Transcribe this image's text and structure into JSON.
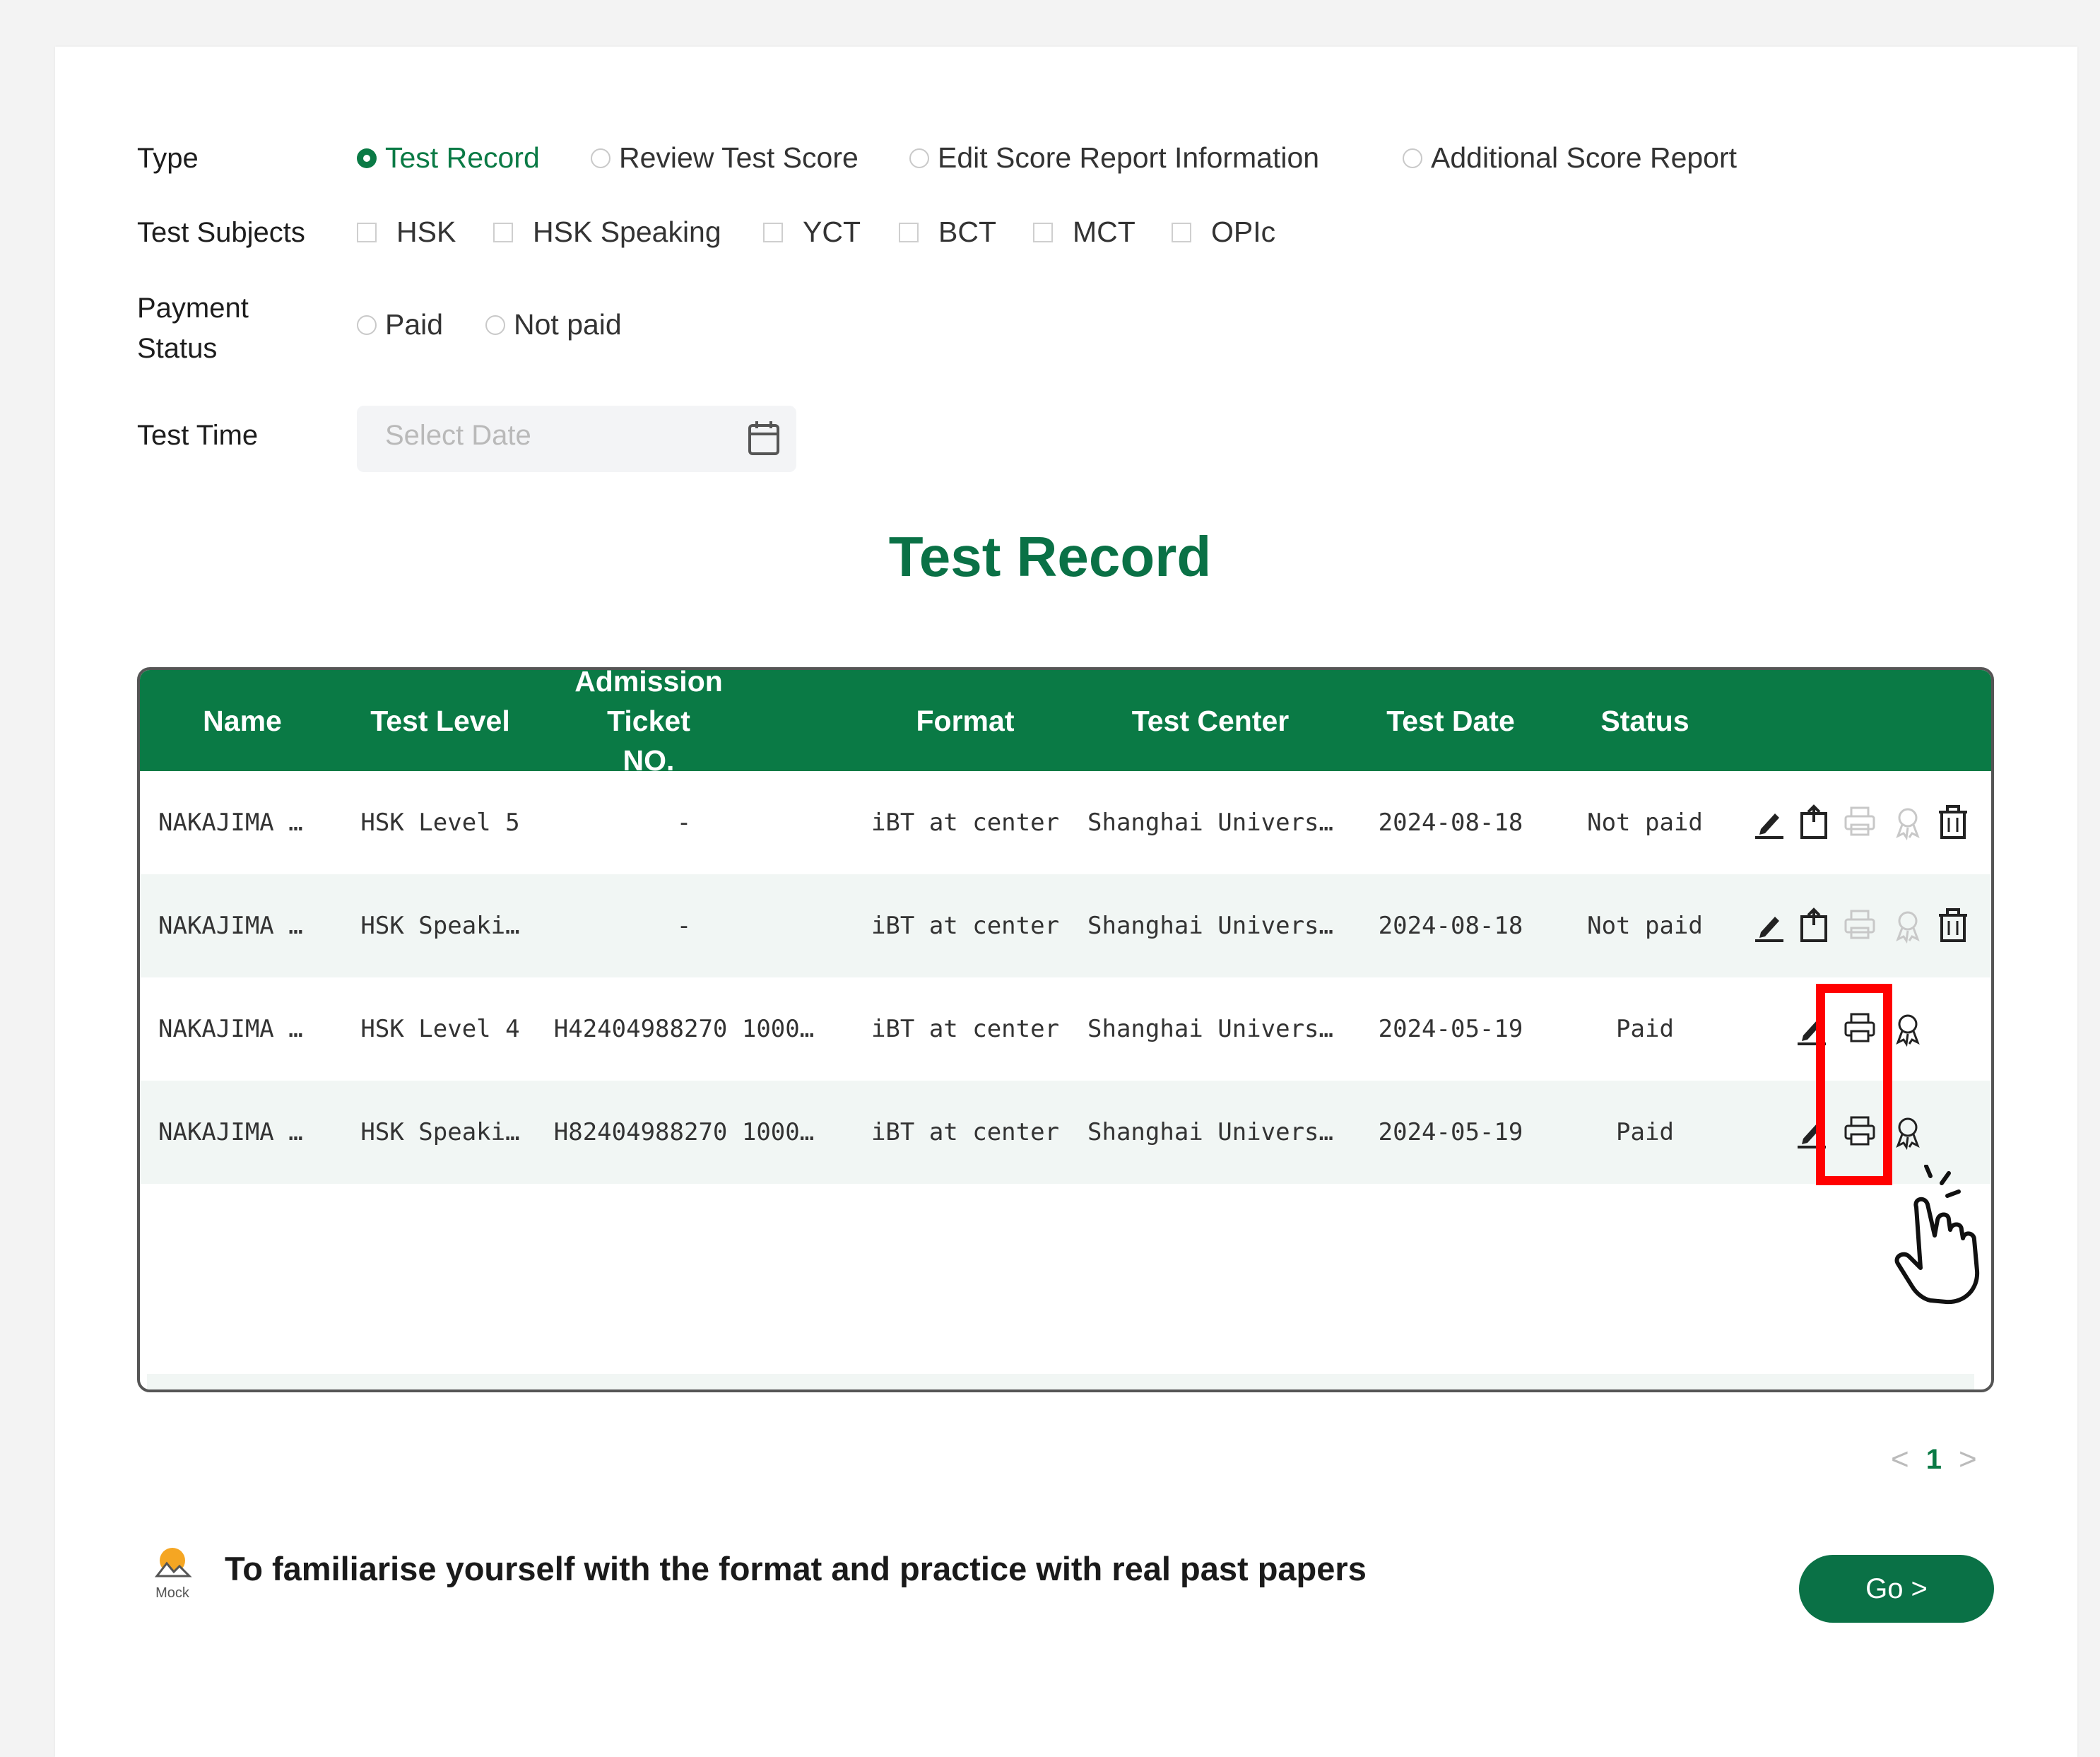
{
  "filters": {
    "type": {
      "label": "Type",
      "options": [
        {
          "label": "Test Record",
          "checked": true
        },
        {
          "label": "Review Test Score",
          "checked": false
        },
        {
          "label": "Edit Score Report Information",
          "checked": false
        },
        {
          "label": "Additional Score Report",
          "checked": false
        }
      ]
    },
    "subjects": {
      "label": "Test Subjects",
      "options": [
        "HSK",
        "HSK Speaking",
        "YCT",
        "BCT",
        "MCT",
        "OPIc"
      ]
    },
    "payment": {
      "label_line1": "Payment",
      "label_line2": "Status",
      "options": [
        "Paid",
        "Not paid"
      ]
    },
    "test_time": {
      "label": "Test Time",
      "placeholder": "Select Date"
    }
  },
  "title": "Test Record",
  "table": {
    "headers": {
      "name": "Name",
      "level": "Test Level",
      "ticket_line1": "Admission Ticket",
      "ticket_line2": "NO.",
      "format": "Format",
      "center": "Test Center",
      "date": "Test Date",
      "status": "Status"
    },
    "rows": [
      {
        "name": "NAKAJIMA …",
        "level": "HSK Level 5",
        "ticket": "-",
        "format": "iBT at center",
        "center": "Shanghai Univers…",
        "date": "2024-08-18",
        "status": "Not paid"
      },
      {
        "name": "NAKAJIMA …",
        "level": "HSK Speaki…",
        "ticket": "-",
        "format": "iBT at center",
        "center": "Shanghai Univers…",
        "date": "2024-08-18",
        "status": "Not paid"
      },
      {
        "name": "NAKAJIMA …",
        "level": "HSK Level 4",
        "ticket": "H42404988270 1000…",
        "format": "iBT at center",
        "center": "Shanghai Univers…",
        "date": "2024-05-19",
        "status": "Paid"
      },
      {
        "name": "NAKAJIMA …",
        "level": "HSK Speaki…",
        "ticket": "H82404988270 1000…",
        "format": "iBT at center",
        "center": "Shanghai Univers…",
        "date": "2024-05-19",
        "status": "Paid"
      }
    ]
  },
  "pagination": {
    "prev": "<",
    "page": "1",
    "next": ">"
  },
  "promo": {
    "icon_label": "Mock",
    "text": "To familiarise yourself with the format and practice with real past papers",
    "button": "Go >"
  },
  "colors": {
    "brand_green": "#0a7a45",
    "highlight_red": "#ff0000"
  }
}
